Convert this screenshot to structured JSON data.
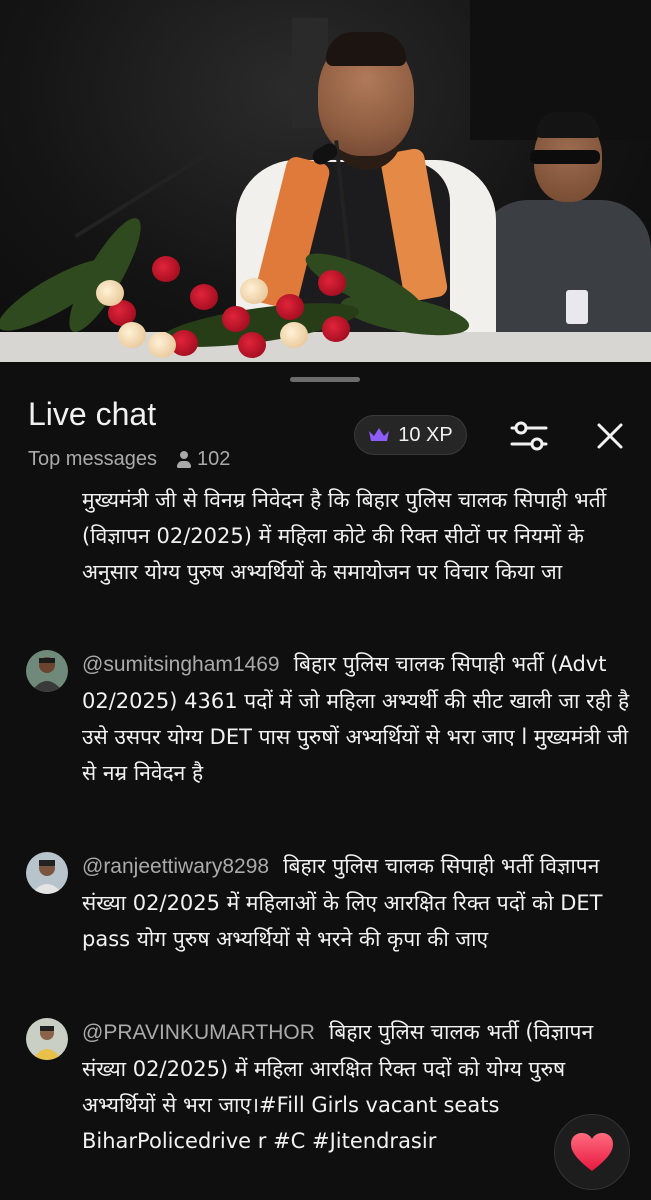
{
  "video": {
    "description_icon": "live-video-frame"
  },
  "chat": {
    "title": "Live chat",
    "filter_label": "Top messages",
    "viewer_count": "102",
    "xp_label": "10 XP",
    "icons": {
      "crown": "crown-icon",
      "settings": "tune-sliders-icon",
      "close": "close-icon",
      "viewers": "person-icon",
      "reaction": "heart-icon"
    },
    "colors": {
      "background": "#0f0f0f",
      "author": "#aaaaaa",
      "heart": "#ff3355",
      "crown": "#8e5cf7"
    }
  },
  "messages": {
    "first_partial": {
      "text": "मुख्यमंत्री जी से विनम्र निवेदन है कि बिहार पुलिस चालक सिपाही भर्ती (विज्ञापन 02/2025) में महिला कोटे की रिक्त सीटों पर नियमों के अनुसार योग्य पुरुष अभ्यर्थियों के समायोजन पर विचार किया जा"
    },
    "items": [
      {
        "author": "@sumitsingham1469",
        "text": "बिहार पुलिस चालक सिपाही भर्ती (Advt 02/2025) 4361 पदों में जो महिला अभ्यर्थी की सीट खाली जा रही है उसे उसपर योग्य DET पास पुरुषों अभ्यर्थियों से भरा जाए l मुख्यमंत्री जी से नम्र निवेदन है"
      },
      {
        "author": "@ranjeettiwary8298",
        "text": "बिहार पुलिस चालक सिपाही भर्ती विज्ञापन संख्या 02/2025 में महिलाओं के लिए आरक्षित रिक्त पदों को DET pass योग पुरुष अभ्यर्थियों से भरने की कृपा की जाए"
      },
      {
        "author": "@PRAVINKUMARTHOR",
        "text": "बिहार पुलिस चालक भर्ती (विज्ञापन संख्या 02/2025) में महिला आरक्षित रिक्त पदों को योग्य पुरुष अभ्यर्थियों से भरा जाए।#Fill Girls vacant seats BiharPolicedrive r #C #Jitendrasir"
      }
    ]
  }
}
